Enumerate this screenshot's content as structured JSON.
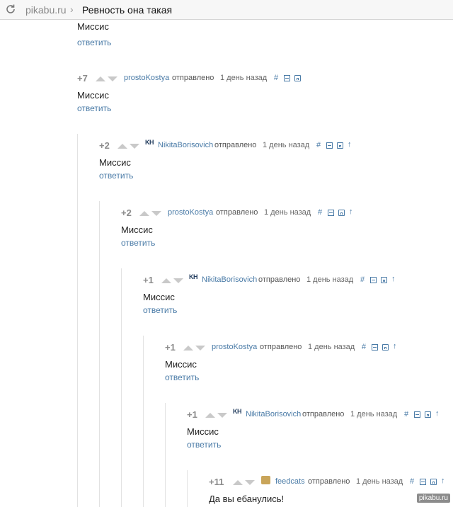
{
  "browser": {
    "domain": "pikabu.ru",
    "separator": "›",
    "page_title": "Ревность она такая"
  },
  "first_comment": {
    "text": "Миссис",
    "reply": "ответить"
  },
  "common": {
    "sent": "отправлено",
    "time": "1 день назад",
    "hash": "#",
    "reply": "ответить",
    "up_arrow": "↑"
  },
  "comments": [
    {
      "rating": "+7",
      "user": "prostoKostya",
      "avatar": "",
      "text": "Миссис",
      "has_reply": true,
      "has_parent_link": false
    },
    {
      "rating": "+2",
      "user": "NikitaBorisovich",
      "avatar": "KH",
      "text": "Миссис",
      "has_reply": true,
      "has_parent_link": true
    },
    {
      "rating": "+2",
      "user": "prostoKostya",
      "avatar": "",
      "text": "Миссис",
      "has_reply": true,
      "has_parent_link": true
    },
    {
      "rating": "+1",
      "user": "NikitaBorisovich",
      "avatar": "KH",
      "text": "Миссис",
      "has_reply": true,
      "has_parent_link": true
    },
    {
      "rating": "+1",
      "user": "prostoKostya",
      "avatar": "",
      "text": "Миссис",
      "has_reply": true,
      "has_parent_link": true
    },
    {
      "rating": "+1",
      "user": "NikitaBorisovich",
      "avatar": "KH",
      "text": "Миссис",
      "has_reply": true,
      "has_parent_link": true
    },
    {
      "rating": "+11",
      "user": "feedcats",
      "avatar": "doge",
      "text": "Да вы ебанулись!",
      "has_reply": false,
      "has_parent_link": true
    }
  ],
  "watermark": "pikabu.ru",
  "colors": {
    "link": "#4a7ba7",
    "rating": "#8c8c8c",
    "vote": "#c9c9c9"
  }
}
